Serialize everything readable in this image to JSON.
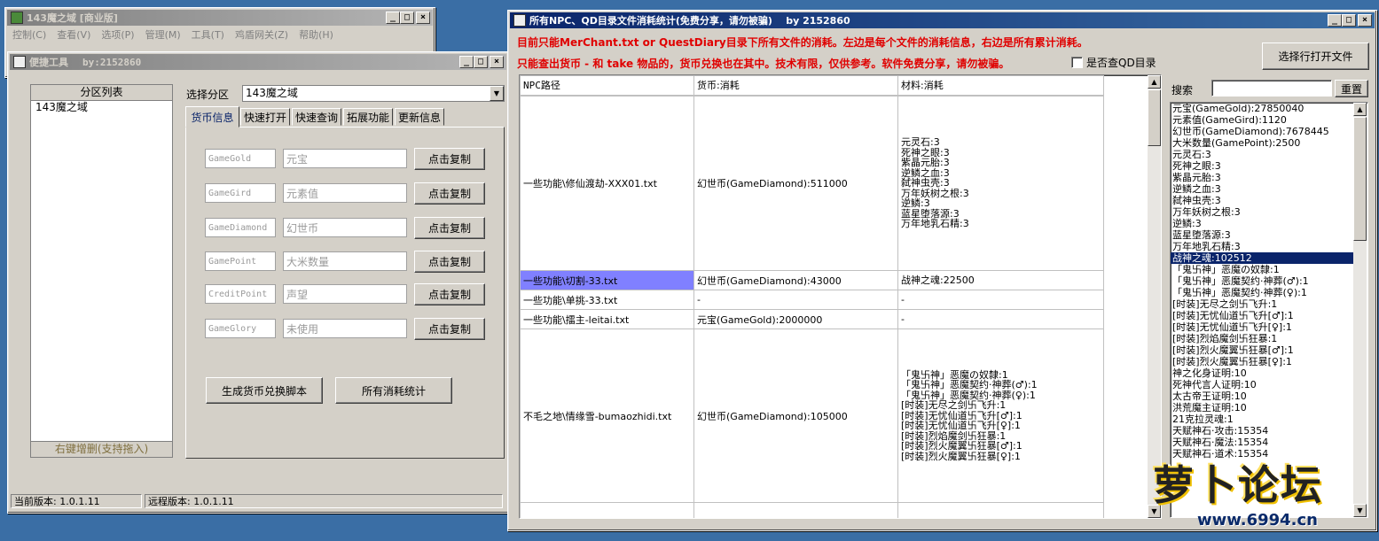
{
  "main_window": {
    "title": "143魔之域 [商业版]",
    "menu": [
      "控制(C)",
      "查看(V)",
      "选项(P)",
      "管理(M)",
      "工具(T)",
      "鸡盾网关(Z)",
      "帮助(H)"
    ]
  },
  "tool_window": {
    "title": "便捷工具",
    "author": "by:2152860",
    "partition_list_header": "分区列表",
    "partitions": [
      "143魔之域"
    ],
    "partition_footer": "右键增删(支持拖入)",
    "select_label": "选择分区",
    "select_value": "143魔之域",
    "tabs": [
      "货币信息",
      "快速打开",
      "快速查询",
      "拓展功能",
      "更新信息"
    ],
    "currency_rows": [
      {
        "code": "GameGold",
        "name": "元宝",
        "button": "点击复制"
      },
      {
        "code": "GameGird",
        "name": "元素值",
        "button": "点击复制"
      },
      {
        "code": "GameDiamond",
        "name": "幻世币",
        "button": "点击复制"
      },
      {
        "code": "GamePoint",
        "name": "大米数量",
        "button": "点击复制"
      },
      {
        "code": "CreditPoint",
        "name": "声望",
        "button": "点击复制"
      },
      {
        "code": "GameGlory",
        "name": "未使用",
        "button": "点击复制"
      }
    ],
    "generate_button": "生成货币兑换脚本",
    "stats_button": "所有消耗统计",
    "status": {
      "local": "当前版本: 1.0.1.11",
      "remote": "远程版本: 1.0.1.11"
    }
  },
  "stats_window": {
    "title": "所有NPC、QD目录文件消耗统计(免费分享，请勿被骗)    by 2152860",
    "notice1": "目前只能MerChant.txt or QuestDiary目录下所有文件的消耗。左边是每个文件的消耗信息，右边是所有累计消耗。",
    "notice2": "只能查出货币 - 和 take 物品的，货币兑换也在其中。技术有限，仅供参考。软件免费分享，请勿被骗。",
    "checkbox_label": "是否查QD目录",
    "open_button": "选择行打开文件",
    "search_label": "搜索",
    "reset_button": "重置",
    "columns": [
      "NPC路径",
      "货币:消耗",
      "材料:消耗"
    ],
    "rows": [
      {
        "path": "一些功能\\修仙渡劫-XXX01.txt",
        "currency": "幻世币(GameDiamond):511000",
        "materials": [
          "元灵石:3",
          "死神之眼:3",
          "紫晶元胎:3",
          "逆鳞之血:3",
          "弑神虫壳:3",
          "万年妖树之根:3",
          "逆鳞:3",
          "蓝星堕落源:3",
          "万年地乳石精:3"
        ]
      },
      {
        "path": "一些功能\\切割-33.txt",
        "currency": "幻世币(GameDiamond):43000",
        "materials": [
          "战神之魂:22500"
        ]
      },
      {
        "path": "一些功能\\单挑-33.txt",
        "currency": "-",
        "materials": [
          "-"
        ]
      },
      {
        "path": "一些功能\\擂主-leitai.txt",
        "currency": "元宝(GameGold):2000000",
        "materials": [
          "-"
        ]
      },
      {
        "path": "不毛之地\\情缘雪-bumaozhidi.txt",
        "currency": "幻世币(GameDiamond):105000",
        "materials": [
          "「鬼卐神」恶魔の奴隸:1",
          "「鬼卐神」恶魔契约·神葬(♂):1",
          "「鬼卐神」恶魔契约·神葬(♀):1",
          "[时装]无尽之剑卐飞升:1",
          "[时装]无忧仙道卐飞升[♂]:1",
          "[时装]无忧仙道卐飞升[♀]:1",
          "[时装]烈焰魔剑卐狂暴:1",
          "[时装]烈火魔翼卐狂暴[♂]:1",
          "[时装]烈火魔翼卐狂暴[♀]:1"
        ]
      }
    ],
    "summary": [
      "元宝(GameGold):27850040",
      "元素值(GameGird):1120",
      "幻世币(GameDiamond):7678445",
      "大米数量(GamePoint):2500",
      "元灵石:3",
      "死神之眼:3",
      "紫晶元胎:3",
      "逆鳞之血:3",
      "弑神虫壳:3",
      "万年妖树之根:3",
      "逆鳞:3",
      "蓝星堕落源:3",
      "万年地乳石精:3",
      "战神之魂:102512",
      "「鬼卐神」恶魔の奴隸:1",
      "「鬼卐神」恶魔契约·神葬(♂):1",
      "「鬼卐神」恶魔契约·神葬(♀):1",
      "[时装]无尽之剑卐飞升:1",
      "[时装]无忧仙道卐飞升[♂]:1",
      "[时装]无忧仙道卐飞升[♀]:1",
      "[时装]烈焰魔剑卐狂暴:1",
      "[时装]烈火魔翼卐狂暴[♂]:1",
      "[时装]烈火魔翼卐狂暴[♀]:1",
      "神之化身证明:10",
      "死神代言人证明:10",
      "太古帝王证明:10",
      "洪荒魔主证明:10",
      "21克拉灵魂:1",
      "天赋神石·攻击:15354",
      "天赋神石·魔法:15354",
      "天赋神石·道术:15354"
    ],
    "summary_selected_index": 13
  },
  "watermark": {
    "text": "萝卜论坛",
    "url": "www.6994.cn"
  }
}
